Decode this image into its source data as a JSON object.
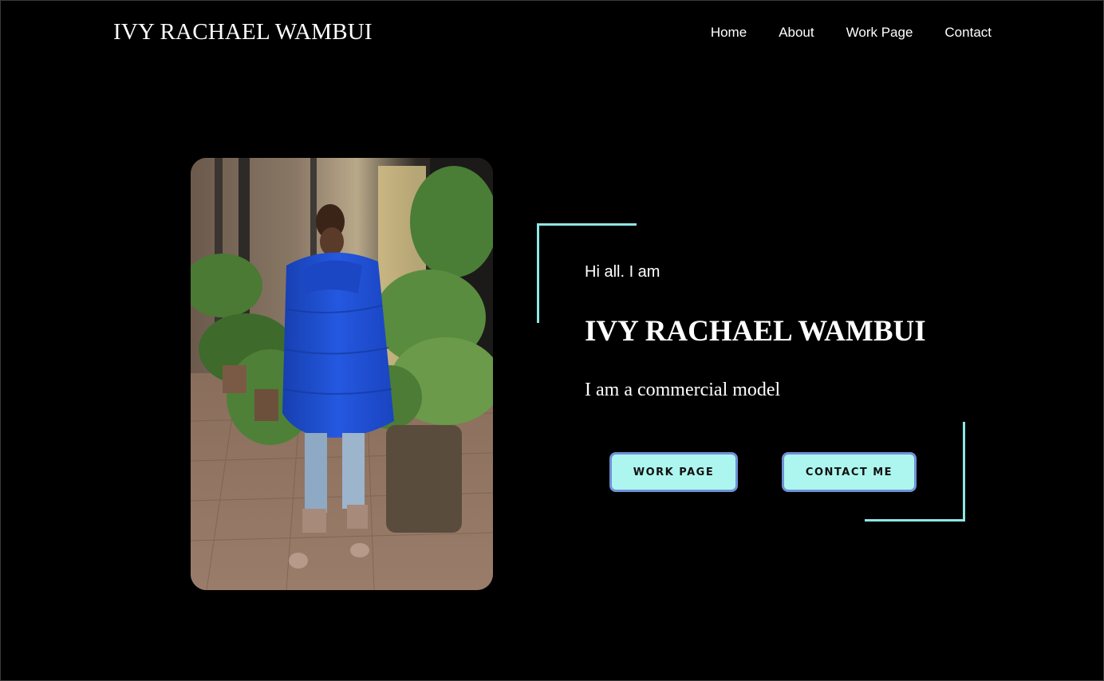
{
  "header": {
    "brand": "IVY RACHAEL WAMBUI",
    "nav": [
      {
        "label": "Home"
      },
      {
        "label": "About"
      },
      {
        "label": "Work Page"
      },
      {
        "label": "Contact"
      }
    ]
  },
  "hero": {
    "greeting": "Hi all. I am",
    "name": "IVY RACHAEL WAMBUI",
    "tagline": "I am a commercial model",
    "buttons": {
      "work": "WORK PAGE",
      "contact": "CONTACT ME"
    },
    "photo_alt": "Model in a blue puffer coat standing among potted plants"
  },
  "colors": {
    "background": "#000000",
    "accent": "#8ee6e3",
    "button_fill": "#adf6ef",
    "button_border": "#6f92d6",
    "coat_blue": "#1f4fd1"
  }
}
